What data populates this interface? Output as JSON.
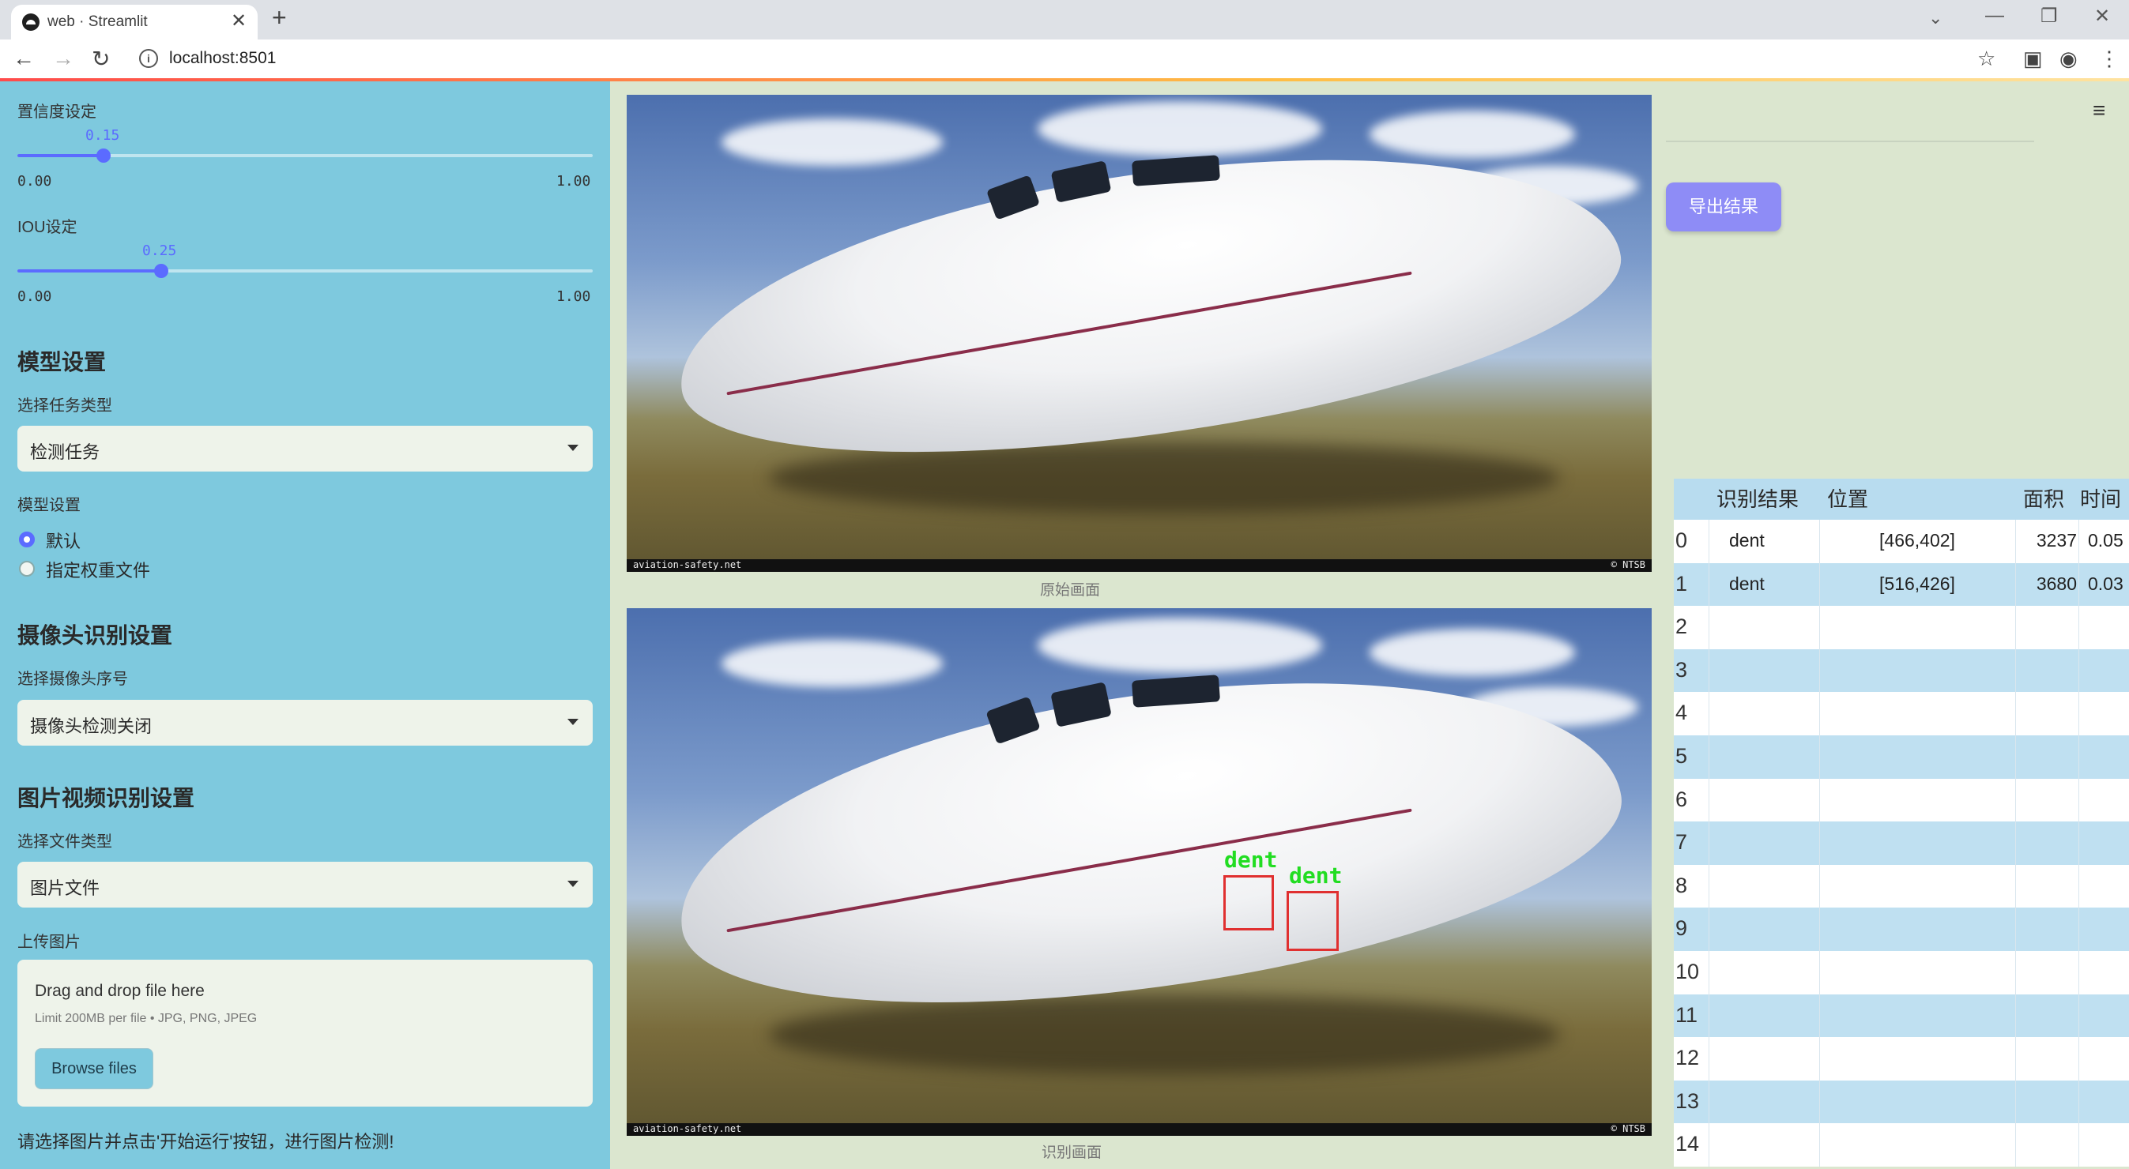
{
  "browser": {
    "tab_title": "web · Streamlit",
    "tab_close": "✕",
    "new_tab": "+",
    "address": "localhost:8501"
  },
  "sidebar": {
    "confidence": {
      "label": "置信度设定",
      "value": "0.15",
      "min": "0.00",
      "max": "1.00",
      "fraction": 0.15
    },
    "iou": {
      "label": "IOU设定",
      "value": "0.25",
      "min": "0.00",
      "max": "1.00",
      "fraction": 0.25
    },
    "model_section": {
      "header": "模型设置",
      "task_label": "选择任务类型",
      "task_value": "检测任务",
      "model_label": "模型设置",
      "options": [
        {
          "label": "默认",
          "checked": true
        },
        {
          "label": "指定权重文件",
          "checked": false
        }
      ]
    },
    "camera_section": {
      "header": "摄像头识别设置",
      "camera_label": "选择摄像头序号",
      "camera_value": "摄像头检测关闭"
    },
    "file_section": {
      "header": "图片视频识别设置",
      "filetype_label": "选择文件类型",
      "filetype_value": "图片文件",
      "upload_label": "上传图片",
      "drop_title": "Drag and drop file here",
      "drop_limit": "Limit 200MB per file • JPG, PNG, JPEG",
      "browse_label": "Browse files"
    },
    "hint": "请选择图片并点击'开始运行'按钮，进行图片检测!"
  },
  "main": {
    "original_caption": "原始画面",
    "result_caption": "识别画面",
    "watermark_left": "aviation-safety.net",
    "watermark_right": "© NTSB",
    "detections": [
      {
        "label": "dent"
      },
      {
        "label": "dent"
      }
    ]
  },
  "right_panel": {
    "export_label": "导出结果",
    "table": {
      "columns": [
        "识别结果",
        "位置",
        "面积",
        "时间"
      ],
      "rows": [
        {
          "idx": "0",
          "result": "dent",
          "position": "[466,402]",
          "area": "3237",
          "time": "0.05"
        },
        {
          "idx": "1",
          "result": "dent",
          "position": "[516,426]",
          "area": "3680",
          "time": "0.03"
        },
        {
          "idx": "2"
        },
        {
          "idx": "3"
        },
        {
          "idx": "4"
        },
        {
          "idx": "5"
        },
        {
          "idx": "6"
        },
        {
          "idx": "7"
        },
        {
          "idx": "8"
        },
        {
          "idx": "9"
        },
        {
          "idx": "10"
        },
        {
          "idx": "11"
        },
        {
          "idx": "12"
        },
        {
          "idx": "13"
        },
        {
          "idx": "14"
        }
      ]
    }
  },
  "colors": {
    "sidebar": "#7ec9de",
    "accent": "#5b6bff",
    "export_button": "#8e8cf6",
    "table_stripe": "#bfe0f1"
  }
}
